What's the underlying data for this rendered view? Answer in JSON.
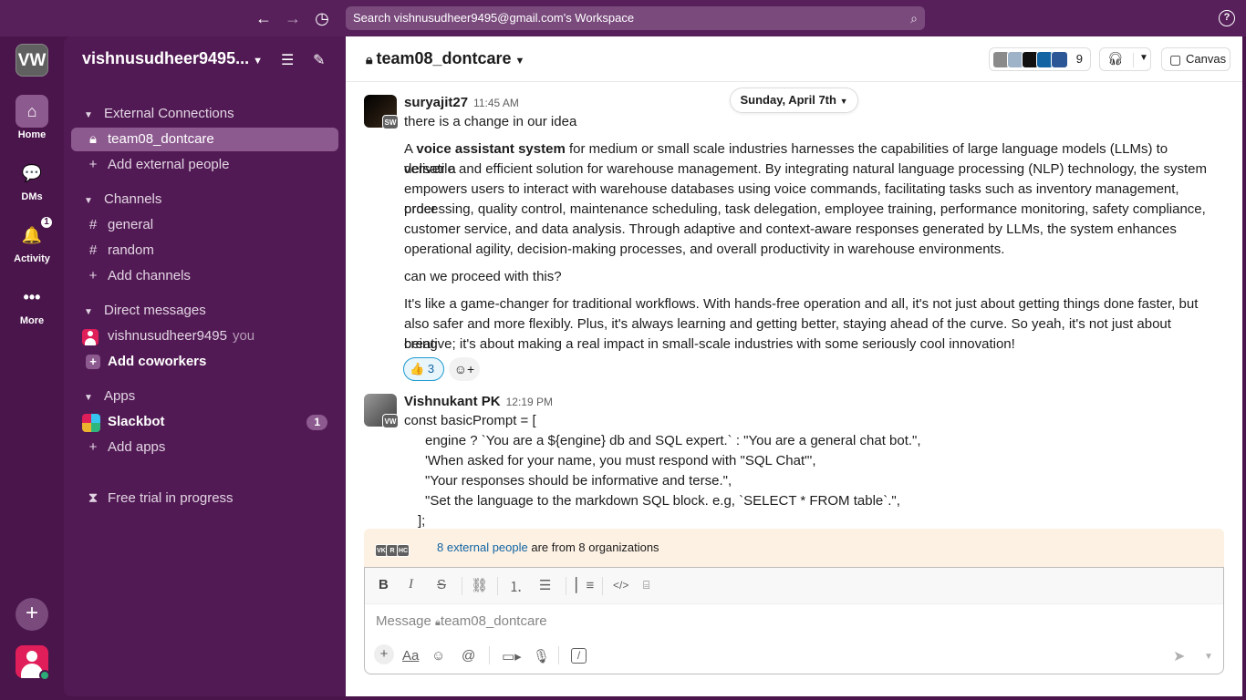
{
  "topbar": {
    "search_placeholder": "Search vishnusudheer9495@gmail.com's Workspace",
    "back_icon": "arrow-left-icon",
    "forward_icon": "arrow-right-icon",
    "history_icon": "clock-icon",
    "help_label": "?"
  },
  "rail": {
    "workspace_initials": "VW",
    "items": [
      {
        "label": "Home",
        "icon": "home-icon"
      },
      {
        "label": "DMs",
        "icon": "dms-icon"
      },
      {
        "label": "Activity",
        "icon": "bell-icon",
        "badge": "1"
      },
      {
        "label": "More",
        "icon": "more-icon"
      }
    ],
    "add_label": "+"
  },
  "sidebar": {
    "workspace_name": "vishnusudheer9495...",
    "sections": {
      "external": "External Connections",
      "channels": "Channels",
      "dms": "Direct messages",
      "apps": "Apps"
    },
    "external_items": [
      "team08_dontcare",
      "Add external people"
    ],
    "channels": [
      "general",
      "random",
      "Add channels"
    ],
    "dm_user": "vishnusudheer9495",
    "dm_you": "you",
    "add_coworkers": "Add coworkers",
    "apps": [
      {
        "label": "Slackbot",
        "badge": "1"
      },
      {
        "label": "Add apps"
      }
    ],
    "free_trial": "Free trial in progress"
  },
  "channel": {
    "title": "team08_dontcare",
    "member_count": "9",
    "canvas_label": "Canvas",
    "date_pill": "Sunday, April 7th"
  },
  "messages": [
    {
      "author": "suryajit27",
      "time": "11:45 AM",
      "avatar_sub": "SW",
      "line1": "there is a change in our idea",
      "para_bold": "voice assistant system",
      "para_a": "A",
      "para_lines": [
        "for medium or small scale industries harnesses the capabilities of large language models (LLMs) to deliver a",
        "versatile and efficient solution for warehouse management. By integrating natural language processing (NLP) technology, the system",
        "empowers users to interact with warehouse databases using voice commands, facilitating tasks such as inventory management, order",
        "processing, quality control, maintenance scheduling, task delegation, employee training, performance monitoring, safety compliance,",
        "customer service, and data analysis. Through adaptive and context-aware responses generated by LLMs, the system enhances",
        "operational agility, decision-making processes, and overall productivity in warehouse environments."
      ],
      "question": "can we proceed with this?",
      "closing_lines": [
        "It's like a game-changer for traditional workflows. With hands-free operation and all, it's not just about getting things done faster, but",
        "also safer and more flexibly. Plus, it's always learning and getting better, staying ahead of the curve. So yeah, it's not just about being",
        "creative; it's about making a real impact in small-scale industries with some seriously cool innovation!"
      ],
      "reaction_emoji": "👍",
      "reaction_count": "3"
    },
    {
      "author": "Vishnukant PK",
      "time": "12:19 PM",
      "avatar_sub": "VW",
      "code_lines": [
        "const basicPrompt = [",
        "engine ? `You are a ${engine} db and SQL expert.` : \"You are a general chat bot.\",",
        "'When asked for your name, you must respond with \"SQL Chat\"',",
        "\"Your responses should be informative and terse.\",",
        "\"Set the language to the markdown SQL block. e.g, `SELECT * FROM table`.\",",
        "];"
      ]
    }
  ],
  "external_banner": {
    "avatars": [
      "VK",
      "R",
      "HC"
    ],
    "link_text": "8 external people",
    "rest_text": "are from 8 organizations"
  },
  "composer": {
    "placeholder_prefix": "Message",
    "placeholder_channel": "team08_dontcare",
    "format_icons": [
      "bold-icon",
      "italic-icon",
      "strikethrough-icon",
      "link-icon",
      "ordered-list-icon",
      "bullet-list-icon",
      "blockquote-icon",
      "code-icon",
      "code-block-icon"
    ],
    "bottom_icons": [
      "plus-icon",
      "text-format-icon",
      "emoji-icon",
      "mention-icon",
      "video-icon",
      "microphone-icon",
      "slash-command-icon"
    ]
  },
  "colors": {
    "rail_bg": "#4a154b",
    "sidebar_bg": "#521a54",
    "active_item": "#8d5a90",
    "link": "#1264a3",
    "banner": "#fcf1e3"
  }
}
